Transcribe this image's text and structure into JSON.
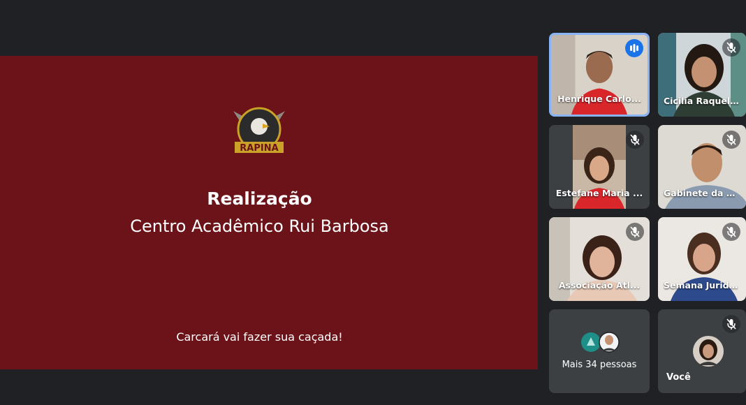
{
  "slide": {
    "logo_text": "RAPINA",
    "title": "Realização",
    "subtitle": "Centro Acadêmico Rui Barbosa",
    "tagline": "Carcará vai fazer sua caçada!"
  },
  "participants": [
    {
      "name": "Henrique Carlo...",
      "status": "speaking",
      "icon": "speaking-indicator-icon"
    },
    {
      "name": "Cicilia Raquel ...",
      "status": "muted",
      "icon": "mic-off-icon"
    },
    {
      "name": "Estefane Maria ...",
      "status": "muted",
      "icon": "mic-off-icon"
    },
    {
      "name": "Gabinete da PR...",
      "status": "muted",
      "icon": "mic-off-icon"
    },
    {
      "name": "Associação Atl...",
      "status": "muted",
      "icon": "mic-off-icon"
    },
    {
      "name": "Semana Juridic...",
      "status": "muted",
      "icon": "mic-off-icon"
    }
  ],
  "more_people": {
    "label": "Mais 34 pessoas"
  },
  "self": {
    "name": "Você",
    "status": "muted",
    "icon": "mic-off-icon"
  },
  "colors": {
    "background": "#202124",
    "slide_background": "#6b1318",
    "tile_background": "#3c4043",
    "speaking_border": "#8ab4f8",
    "speaking_badge": "#1a73e8"
  }
}
